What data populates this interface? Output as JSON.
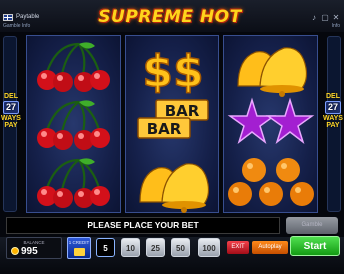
{
  "header": {
    "paytable_label": "Paytable",
    "gamble_label": "Gamble Info",
    "title": "SUPREME HOT",
    "settings_label": "Info"
  },
  "side_panels": {
    "left": {
      "label_top": "DEL",
      "number": "27",
      "label_mid": "WAYS",
      "label_bottom": "PAY"
    },
    "right": {
      "label_top": "DEL",
      "number": "27",
      "label_mid": "WAYS",
      "label_bottom": "PAY"
    }
  },
  "reels": [
    [
      "cherries",
      "cherries",
      "cherries"
    ],
    [
      "dollar",
      "bar",
      "bell"
    ],
    [
      "bell",
      "star",
      "orange"
    ]
  ],
  "symbol_text": {
    "bar_top": "BAR",
    "bar_bottom": "BAR",
    "dollar": "$$"
  },
  "message": "PLEASE PLACE YOUR BET",
  "gamble_button": "Gamble",
  "balance": {
    "label": "BALANCE",
    "value": "995"
  },
  "credit": {
    "label": "1 CREDIT"
  },
  "bets": [
    {
      "label": "5",
      "selected": true
    },
    {
      "label": "10",
      "selected": false
    },
    {
      "label": "25",
      "selected": false
    },
    {
      "label": "50",
      "selected": false
    },
    {
      "label": "100",
      "selected": false
    }
  ],
  "exit_label": "EXIT",
  "autoplay_label": "Autoplay",
  "start_label": "Start",
  "colors": {
    "title": "#ffd41c",
    "reel_bg": "#15204a",
    "start": "#2bbf2b",
    "exit": "#d3202c",
    "autoplay": "#f07a10"
  }
}
